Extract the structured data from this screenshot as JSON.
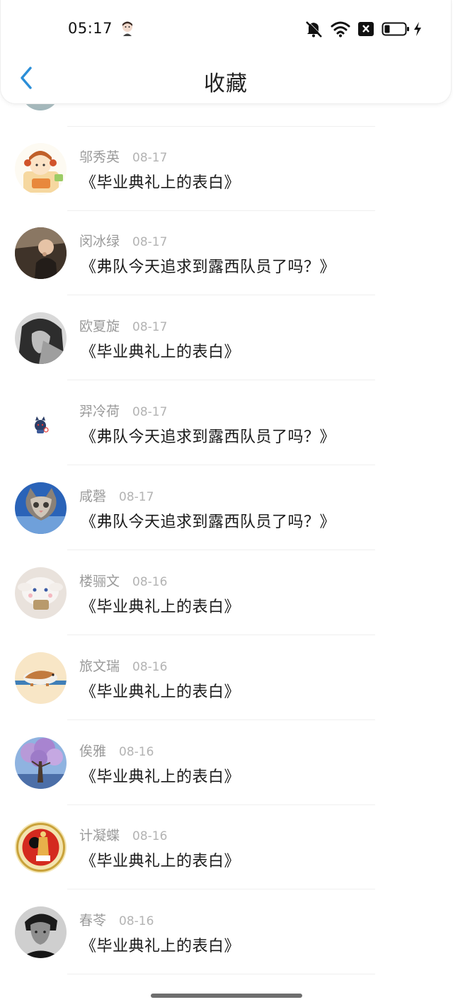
{
  "status_bar": {
    "time": "05:17",
    "icons": [
      "avatar-icon",
      "mute-bell-icon",
      "wifi-icon",
      "close-box-icon",
      "battery-icon",
      "charging-bolt-icon"
    ]
  },
  "nav": {
    "back_icon": "chevron-left-icon",
    "title": "收藏",
    "accent_color": "#2b8ed8"
  },
  "favorites": [
    {
      "name": "邬秀英",
      "date": "08-17",
      "title": "《毕业典礼上的表白》",
      "avatar": "girl-cartoon"
    },
    {
      "name": "闵冰绿",
      "date": "08-17",
      "title": "《弗队今天追求到露西队员了吗？》",
      "avatar": "baby-photo"
    },
    {
      "name": "欧夏旋",
      "date": "08-17",
      "title": "《毕业典礼上的表白》",
      "avatar": "girl-bw-photo"
    },
    {
      "name": "羿冷荷",
      "date": "08-17",
      "title": "《弗队今天追求到露西队员了吗？》",
      "avatar": "small-devil-sticker"
    },
    {
      "name": "咸磬",
      "date": "08-17",
      "title": "《弗队今天追求到露西队员了吗？》",
      "avatar": "kitten-photo"
    },
    {
      "name": "楼骊文",
      "date": "08-16",
      "title": "《毕业典礼上的表白》",
      "avatar": "cinnamoroll-plush"
    },
    {
      "name": "旅文瑞",
      "date": "08-16",
      "title": "《毕业典礼上的表白》",
      "avatar": "hamster-drawing"
    },
    {
      "name": "俟雅",
      "date": "08-16",
      "title": "《毕业典礼上的表白》",
      "avatar": "purple-tree"
    },
    {
      "name": "计凝蝶",
      "date": "08-16",
      "title": "《毕业典礼上的表白》",
      "avatar": "red-emblem"
    },
    {
      "name": "春苓",
      "date": "08-16",
      "title": "《毕业典礼上的表白》",
      "avatar": "man-bw-portrait"
    }
  ]
}
